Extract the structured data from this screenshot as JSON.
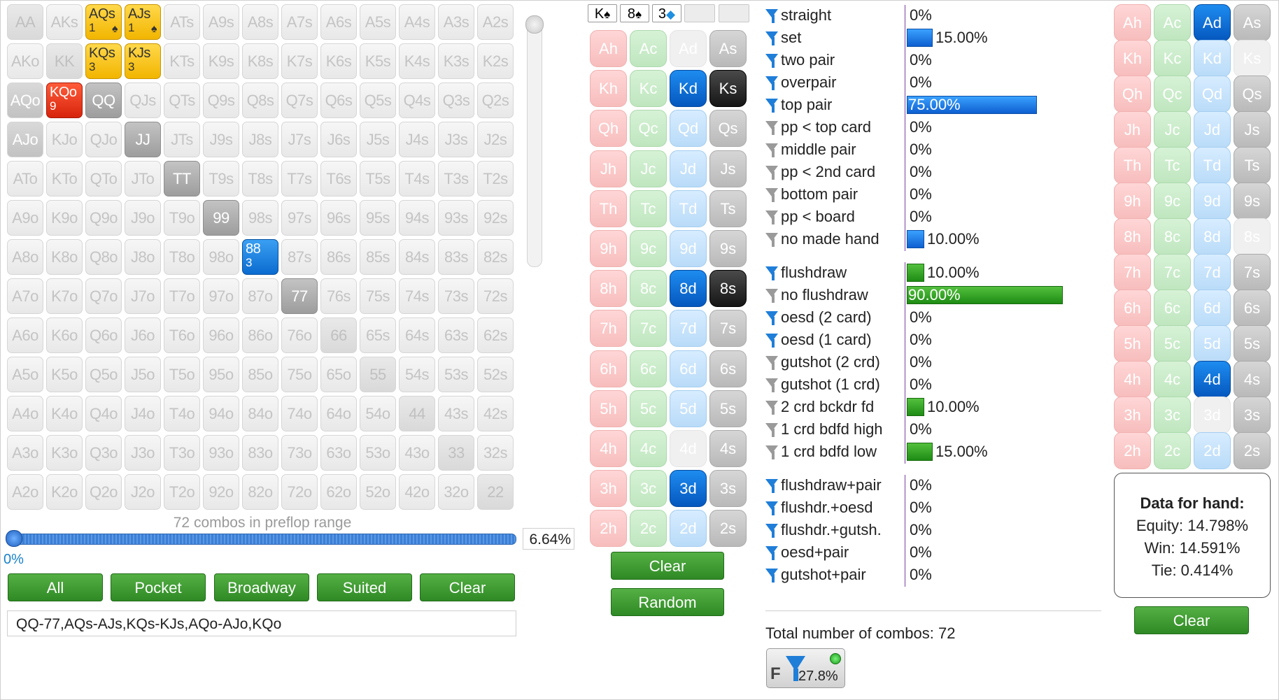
{
  "grid": {
    "cells": [
      [
        "AA",
        "AKs",
        "AQs",
        "AJs",
        "ATs",
        "A9s",
        "A8s",
        "A7s",
        "A6s",
        "A5s",
        "A4s",
        "A3s",
        "A2s"
      ],
      [
        "AKo",
        "KK",
        "KQs",
        "KJs",
        "KTs",
        "K9s",
        "K8s",
        "K7s",
        "K6s",
        "K5s",
        "K4s",
        "K3s",
        "K2s"
      ],
      [
        "AQo",
        "KQo",
        "QQ",
        "QJs",
        "QTs",
        "Q9s",
        "Q8s",
        "Q7s",
        "Q6s",
        "Q5s",
        "Q4s",
        "Q3s",
        "Q2s"
      ],
      [
        "AJo",
        "KJo",
        "QJo",
        "JJ",
        "JTs",
        "J9s",
        "J8s",
        "J7s",
        "J6s",
        "J5s",
        "J4s",
        "J3s",
        "J2s"
      ],
      [
        "ATo",
        "KTo",
        "QTo",
        "JTo",
        "TT",
        "T9s",
        "T8s",
        "T7s",
        "T6s",
        "T5s",
        "T4s",
        "T3s",
        "T2s"
      ],
      [
        "A9o",
        "K9o",
        "Q9o",
        "J9o",
        "T9o",
        "99",
        "98s",
        "97s",
        "96s",
        "95s",
        "94s",
        "93s",
        "92s"
      ],
      [
        "A8o",
        "K8o",
        "Q8o",
        "J8o",
        "T8o",
        "98o",
        "88",
        "87s",
        "86s",
        "85s",
        "84s",
        "83s",
        "82s"
      ],
      [
        "A7o",
        "K7o",
        "Q7o",
        "J7o",
        "T7o",
        "97o",
        "87o",
        "77",
        "76s",
        "75s",
        "74s",
        "73s",
        "72s"
      ],
      [
        "A6o",
        "K6o",
        "Q6o",
        "J6o",
        "T6o",
        "96o",
        "86o",
        "76o",
        "66",
        "65s",
        "64s",
        "63s",
        "62s"
      ],
      [
        "A5o",
        "K5o",
        "Q5o",
        "J5o",
        "T5o",
        "95o",
        "85o",
        "75o",
        "65o",
        "55",
        "54s",
        "53s",
        "52s"
      ],
      [
        "A4o",
        "K4o",
        "Q4o",
        "J4o",
        "T4o",
        "94o",
        "84o",
        "74o",
        "64o",
        "54o",
        "44",
        "43s",
        "42s"
      ],
      [
        "A3o",
        "K3o",
        "Q3o",
        "J3o",
        "T3o",
        "93o",
        "83o",
        "73o",
        "63o",
        "53o",
        "43o",
        "33",
        "32s"
      ],
      [
        "A2o",
        "K2o",
        "Q2o",
        "J2o",
        "T2o",
        "92o",
        "82o",
        "72o",
        "62o",
        "52o",
        "42o",
        "32o",
        "22"
      ]
    ],
    "highlights": {
      "0-2": {
        "style": "yellow",
        "count": "1",
        "suit": "♠"
      },
      "0-3": {
        "style": "yellow",
        "count": "1",
        "suit": "♠"
      },
      "1-2": {
        "style": "yellow",
        "count": "3"
      },
      "1-3": {
        "style": "yellow",
        "count": "3"
      },
      "2-1": {
        "style": "red",
        "count": "9"
      },
      "6-6": {
        "style": "blue",
        "count": "3"
      },
      "2-2": {
        "style": "gray"
      },
      "3-3": {
        "style": "gray"
      },
      "4-4": {
        "style": "gray"
      },
      "5-5": {
        "style": "gray"
      },
      "7-7": {
        "style": "gray"
      },
      "2-0": {
        "style": "gray-light"
      },
      "3-0": {
        "style": "gray-light"
      }
    },
    "combos_text": "72 combos in preflop range",
    "slider_min": "0%",
    "slider_value": "6.64%",
    "slider_fraction": 0.0
  },
  "range_buttons": [
    "All",
    "Pocket",
    "Broadway",
    "Suited",
    "Clear"
  ],
  "range_input": "QQ-77,AQs-AJs,KQs-KJs,AQo-AJo,KQo",
  "board": {
    "slots": [
      {
        "rank": "K",
        "suit": "♠",
        "suit_color": "#000000"
      },
      {
        "rank": "8",
        "suit": "♠",
        "suit_color": "#000000"
      },
      {
        "rank": "3",
        "suit": "◆",
        "suit_color": "#1f8fe0"
      },
      {
        "rank": "",
        "suit": ""
      },
      {
        "rank": "",
        "suit": ""
      }
    ],
    "ranks": [
      "A",
      "K",
      "Q",
      "J",
      "T",
      "9",
      "8",
      "7",
      "6",
      "5",
      "4",
      "3",
      "2"
    ],
    "suits": [
      "h",
      "c",
      "d",
      "s"
    ],
    "selected": [
      "Kd",
      "Ks",
      "8d",
      "8s",
      "3d"
    ],
    "dead": [
      "Ad",
      "4d"
    ],
    "buttons": {
      "clear": "Clear",
      "random": "Random"
    }
  },
  "stats": {
    "groups": [
      [
        {
          "label": "straight",
          "pct": "0%",
          "value": 0,
          "color": "blue",
          "filter": "on"
        },
        {
          "label": "set",
          "pct": "15.00%",
          "value": 15,
          "color": "blue",
          "filter": "on"
        },
        {
          "label": "two pair",
          "pct": "0%",
          "value": 0,
          "color": "blue",
          "filter": "on"
        },
        {
          "label": "overpair",
          "pct": "0%",
          "value": 0,
          "color": "blue",
          "filter": "on"
        },
        {
          "label": "top pair",
          "pct": "75.00%",
          "value": 75,
          "color": "blue",
          "filter": "on"
        },
        {
          "label": "pp < top card",
          "pct": "0%",
          "value": 0,
          "color": "blue",
          "filter": "off"
        },
        {
          "label": "middle pair",
          "pct": "0%",
          "value": 0,
          "color": "blue",
          "filter": "off"
        },
        {
          "label": "pp < 2nd card",
          "pct": "0%",
          "value": 0,
          "color": "blue",
          "filter": "off"
        },
        {
          "label": "bottom pair",
          "pct": "0%",
          "value": 0,
          "color": "blue",
          "filter": "off"
        },
        {
          "label": "pp < board",
          "pct": "0%",
          "value": 0,
          "color": "blue",
          "filter": "off"
        },
        {
          "label": "no made hand",
          "pct": "10.00%",
          "value": 10,
          "color": "blue",
          "filter": "off"
        }
      ],
      [
        {
          "label": "flushdraw",
          "pct": "10.00%",
          "value": 10,
          "color": "green",
          "filter": "on"
        },
        {
          "label": "no flushdraw",
          "pct": "90.00%",
          "value": 90,
          "color": "green",
          "filter": "off"
        },
        {
          "label": "oesd (2 card)",
          "pct": "0%",
          "value": 0,
          "color": "green",
          "filter": "on"
        },
        {
          "label": "oesd (1 card)",
          "pct": "0%",
          "value": 0,
          "color": "green",
          "filter": "on"
        },
        {
          "label": "gutshot (2 crd)",
          "pct": "0%",
          "value": 0,
          "color": "green",
          "filter": "off"
        },
        {
          "label": "gutshot (1 crd)",
          "pct": "0%",
          "value": 0,
          "color": "green",
          "filter": "off"
        },
        {
          "label": "2 crd bckdr fd",
          "pct": "10.00%",
          "value": 10,
          "color": "green",
          "filter": "off"
        },
        {
          "label": "1 crd bdfd high",
          "pct": "0%",
          "value": 0,
          "color": "green",
          "filter": "off"
        },
        {
          "label": "1 crd bdfd low",
          "pct": "15.00%",
          "value": 15,
          "color": "green",
          "filter": "off"
        }
      ],
      [
        {
          "label": "flushdraw+pair",
          "pct": "0%",
          "value": 0,
          "color": "blue",
          "filter": "on"
        },
        {
          "label": "flushdr.+oesd",
          "pct": "0%",
          "value": 0,
          "color": "blue",
          "filter": "on"
        },
        {
          "label": "flushdr.+gutsh.",
          "pct": "0%",
          "value": 0,
          "color": "blue",
          "filter": "on"
        },
        {
          "label": "oesd+pair",
          "pct": "0%",
          "value": 0,
          "color": "blue",
          "filter": "on"
        },
        {
          "label": "gutshot+pair",
          "pct": "0%",
          "value": 0,
          "color": "blue",
          "filter": "on"
        }
      ]
    ],
    "total_label": "Total number of combos: 72",
    "filter_button": {
      "letter": "F",
      "pct": "27.8%"
    }
  },
  "hand": {
    "selected": [
      "Ad",
      "4d"
    ],
    "dead": [
      "Ks",
      "8s",
      "3d"
    ],
    "data_title": "Data for hand:",
    "equity": "Equity: 14.798%",
    "win": "Win: 14.591%",
    "tie": "Tie: 0.414%",
    "clear_label": "Clear"
  }
}
